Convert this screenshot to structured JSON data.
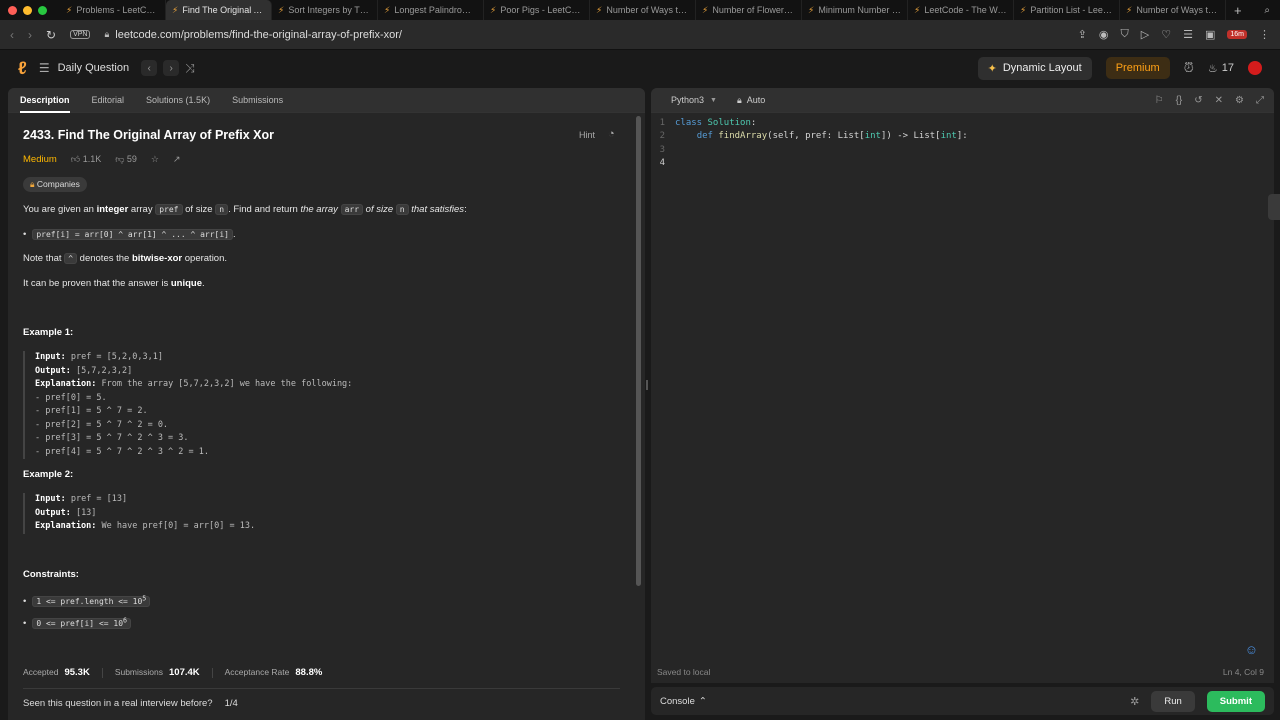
{
  "browser": {
    "tabs": [
      {
        "label": "Problems - LeetCode",
        "active": false
      },
      {
        "label": "Find The Original Array",
        "active": true
      },
      {
        "label": "Sort Integers by The N",
        "active": false
      },
      {
        "label": "Longest Palindromic S",
        "active": false
      },
      {
        "label": "Poor Pigs - LeetCode",
        "active": false
      },
      {
        "label": "Number of Ways to St",
        "active": false
      },
      {
        "label": "Number of Flowers in",
        "active": false
      },
      {
        "label": "Minimum Number of O",
        "active": false
      },
      {
        "label": "LeetCode - The World",
        "active": false
      },
      {
        "label": "Partition List - LeetCo",
        "active": false
      },
      {
        "label": "Number of Ways to Re",
        "active": false
      }
    ],
    "url": "leetcode.com/problems/find-the-original-array-of-prefix-xor/",
    "vpn_label": "VPN",
    "ext_badge": "16m"
  },
  "header": {
    "daily_question": "Daily Question",
    "dynamic_layout": "Dynamic Layout",
    "premium": "Premium",
    "streak": "17"
  },
  "left_tabs": [
    "Description",
    "Editorial",
    "Solutions (1.5K)",
    "Submissions"
  ],
  "problem": {
    "title": "2433. Find The Original Array of Prefix Xor",
    "hint": "Hint",
    "difficulty": "Medium",
    "likes": "1.1K",
    "dislikes": "59",
    "companies": "Companies"
  },
  "description": {
    "p1_a": "You are given an ",
    "p1_b": "integer",
    "p1_c": " array ",
    "p1_code1": "pref",
    "p1_d": " of size ",
    "p1_code2": "n",
    "p1_e": ". Find and return ",
    "p1_f": "the array ",
    "p1_code3": "arr",
    "p1_g": " of size ",
    "p1_code4": "n",
    "p1_h": " that satisfies",
    "p1_i": ":",
    "bullet": "pref[i] = arr[0] ^ arr[1] ^ ... ^ arr[i]",
    "bullet_tail": ".",
    "p2_a": "Note that ",
    "p2_code": "^",
    "p2_b": " denotes the ",
    "p2_c": "bitwise-xor",
    "p2_d": " operation.",
    "p3_a": "It can be proven that the answer is ",
    "p3_b": "unique",
    "p3_c": "."
  },
  "examples": {
    "ex1_title": "Example 1:",
    "ex1_input_label": "Input:",
    "ex1_input": " pref = [5,2,0,3,1]",
    "ex1_output_label": "Output:",
    "ex1_output": " [5,7,2,3,2]",
    "ex1_expl_label": "Explanation:",
    "ex1_expl": " From the array [5,7,2,3,2] we have the following:",
    "ex1_lines": "- pref[0] = 5.\n- pref[1] = 5 ^ 7 = 2.\n- pref[2] = 5 ^ 7 ^ 2 = 0.\n- pref[3] = 5 ^ 7 ^ 2 ^ 3 = 3.\n- pref[4] = 5 ^ 7 ^ 2 ^ 3 ^ 2 = 1.",
    "ex2_title": "Example 2:",
    "ex2_input_label": "Input:",
    "ex2_input": " pref = [13]",
    "ex2_output_label": "Output:",
    "ex2_output": " [13]",
    "ex2_expl_label": "Explanation:",
    "ex2_expl": " We have pref[0] = arr[0] = 13."
  },
  "constraints": {
    "title": "Constraints:",
    "c1": "1 <= pref.length <= 10",
    "c1_sup": "5",
    "c2": "0 <= pref[i] <= 10",
    "c2_sup": "6"
  },
  "stats": {
    "accepted_label": "Accepted",
    "accepted": "95.3K",
    "submissions_label": "Submissions",
    "submissions": "107.4K",
    "rate_label": "Acceptance Rate",
    "rate": "88.8%"
  },
  "seen": {
    "question": "Seen this question in a real interview before?",
    "count": "1/4"
  },
  "editor": {
    "language": "Python3",
    "auto": "Auto",
    "saved": "Saved to local",
    "position": "Ln 4, Col 9",
    "line_numbers": [
      "1",
      "2",
      "3",
      "4"
    ]
  },
  "console": {
    "label": "Console",
    "run": "Run",
    "submit": "Submit"
  },
  "colors": {
    "accent_orange": "#ffa116",
    "medium": "#ffb800",
    "submit_green": "#2cbb5d"
  }
}
